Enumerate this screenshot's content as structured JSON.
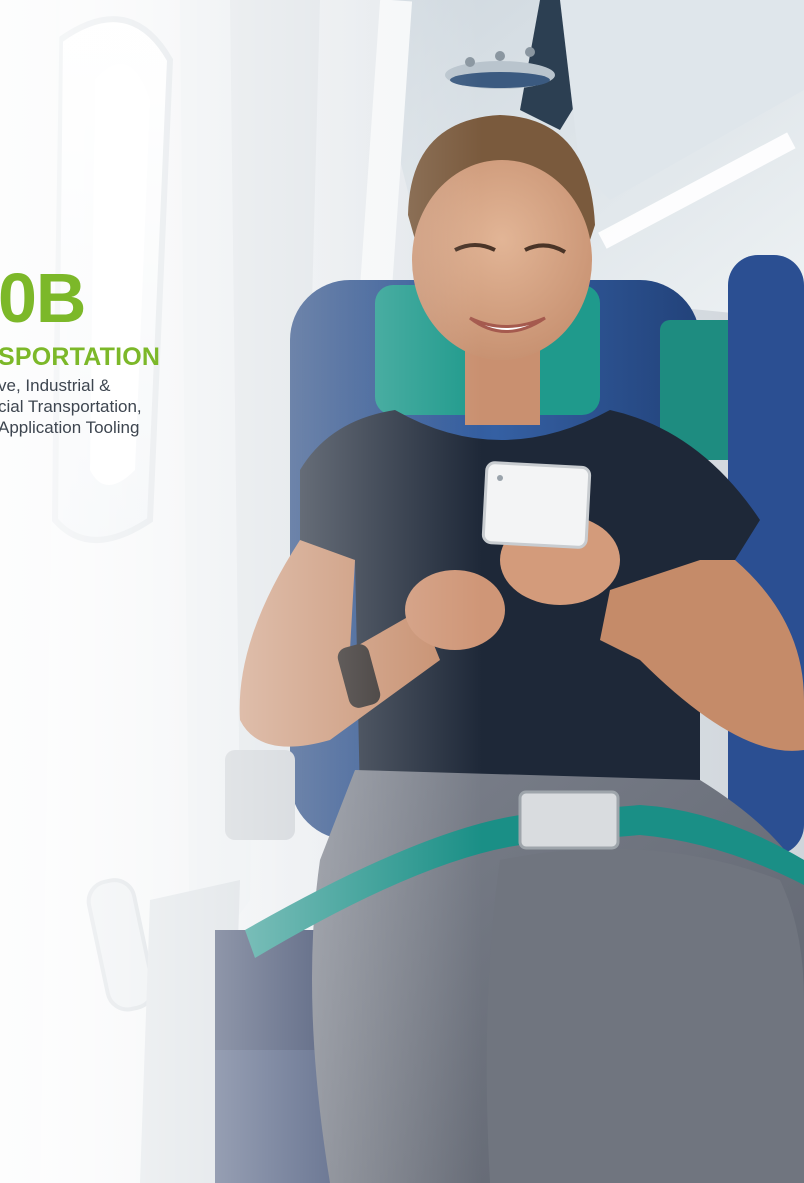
{
  "slide": {
    "headline_value": "0B",
    "segment_title": "SPORTATION",
    "description_lines": [
      "ve, Industrial &",
      "cial Transportation,",
      "Application Tooling"
    ]
  },
  "colors": {
    "accent_green": "#7cb829",
    "body_text": "#3e4650",
    "seat_blue": "#2d4f8e",
    "seat_teal": "#1f9a8c",
    "shirt_navy": "#1e2838",
    "pants_gray": "#6f7480",
    "belt_teal": "#1a8f86"
  },
  "photo": {
    "subject": "woman-smiling-at-phone-in-airplane-seat"
  }
}
